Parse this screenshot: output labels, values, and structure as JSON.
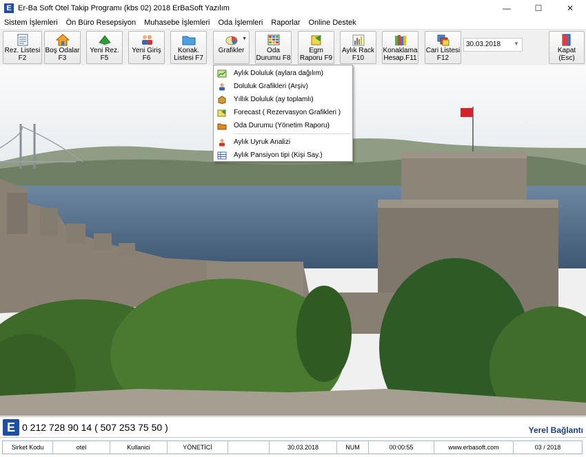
{
  "window": {
    "title": "Er-Ba Soft Otel Takip Programı  (kbs 02) 2018  ErBaSoft Yazılım",
    "app_icon": "E",
    "controls": [
      "—",
      "☐",
      "✕"
    ]
  },
  "menubar": {
    "items": [
      "Sistem İşlemleri",
      "Ön Büro Resepsiyon",
      "Muhasebe İşlemleri",
      "Oda İşlemleri",
      "Raporlar",
      "Online Destek"
    ]
  },
  "toolbar": {
    "buttons": [
      {
        "label": "Rez. Listesi\nF2",
        "icon": "list-icon"
      },
      {
        "label": "Boş Odalar\nF3",
        "icon": "house-icon"
      },
      {
        "label": "Yeni Rez.\nF5",
        "icon": "book-icon"
      },
      {
        "label": "Yeni Giriş\nF6",
        "icon": "users-icon"
      },
      {
        "label": "Konak.\nListesi  F7",
        "icon": "folder-icon"
      },
      {
        "label": "Grafikler",
        "icon": "pie-chart-icon"
      },
      {
        "label": "Oda\nDurumu  F8",
        "icon": "grid-icon"
      },
      {
        "label": "Egm\nRaporu  F9",
        "icon": "report-icon"
      },
      {
        "label": "Aylık Rack\nF10",
        "icon": "bar-chart-icon"
      },
      {
        "label": "Konaklama\nHesap.F11",
        "icon": "books-icon"
      },
      {
        "label": "Cari Listesi\nF12",
        "icon": "cards-icon"
      },
      {
        "label": "Kapat  (Esc)",
        "icon": "exit-door-icon"
      }
    ],
    "date_value": "30.03.2018"
  },
  "grafikler_menu": {
    "items": [
      {
        "label": "Aylık Doluluk (aylara dağılım)",
        "icon": "chart-green-icon"
      },
      {
        "label": "Doluluk Grafikleri (Arşiv)",
        "icon": "person-icon"
      },
      {
        "label": "Yıllık Doluluk (ay toplamlı)",
        "icon": "box-icon"
      },
      {
        "label": "Forecast ( Rezervasyon Grafikleri )",
        "icon": "forecast-icon"
      },
      {
        "label": "Oda Durumu (Yönetim Raporu)",
        "icon": "folder-orange-icon"
      },
      {
        "label": "Aylık Uyruk Analizi",
        "icon": "person-icon"
      },
      {
        "label": "Aylık Pansiyon tipi (Kişi Say.)",
        "icon": "table-icon"
      }
    ]
  },
  "phonebar": {
    "logo": "E",
    "phone": "0 212 728 90 14   ( 507 253 75 50 )",
    "connection": "Yerel Bağlantı"
  },
  "statusbar": {
    "cells": [
      "Sirket Kodu",
      "otel",
      "Kullanici",
      "YÖNETİCİ",
      "",
      "30.03.2018",
      "NUM",
      "00:00:55",
      "www.erbasoft.com",
      "03 / 2018"
    ]
  },
  "colors": {
    "accent": "#1d4fa3",
    "connection": "#1c3f7a"
  }
}
